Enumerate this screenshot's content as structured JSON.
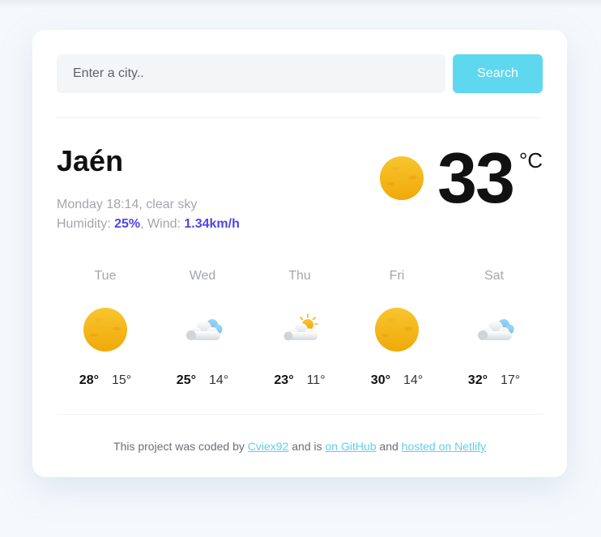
{
  "search": {
    "placeholder": "Enter a city..",
    "button_label": "Search"
  },
  "current": {
    "city": "Jaén",
    "day_time": "Monday 18:14",
    "description": "clear sky",
    "humidity_label": "Humidity: ",
    "humidity": "25%",
    "wind_label": "Wind: ",
    "wind": "1.34km/h",
    "temperature": "33",
    "unit": "°C",
    "icon": "sun-icon"
  },
  "forecast": [
    {
      "day": "Tue",
      "icon": "sun-icon",
      "high": "28°",
      "low": "15°"
    },
    {
      "day": "Wed",
      "icon": "cloudy-icon",
      "high": "25°",
      "low": "14°"
    },
    {
      "day": "Thu",
      "icon": "partly-cloudy-icon",
      "high": "23°",
      "low": "11°"
    },
    {
      "day": "Fri",
      "icon": "sun-icon",
      "high": "30°",
      "low": "14°"
    },
    {
      "day": "Sat",
      "icon": "cloudy-icon",
      "high": "32°",
      "low": "17°"
    }
  ],
  "footer": {
    "text1": "This project was coded by ",
    "link1": "Cviex92",
    "text2": " and is ",
    "link2": "on GitHub",
    "text3": " and ",
    "link3": "hosted on Netlify"
  },
  "colors": {
    "accent": "#5ed8ef",
    "value_highlight": "#4f46e5",
    "sun": "#f5b915"
  }
}
